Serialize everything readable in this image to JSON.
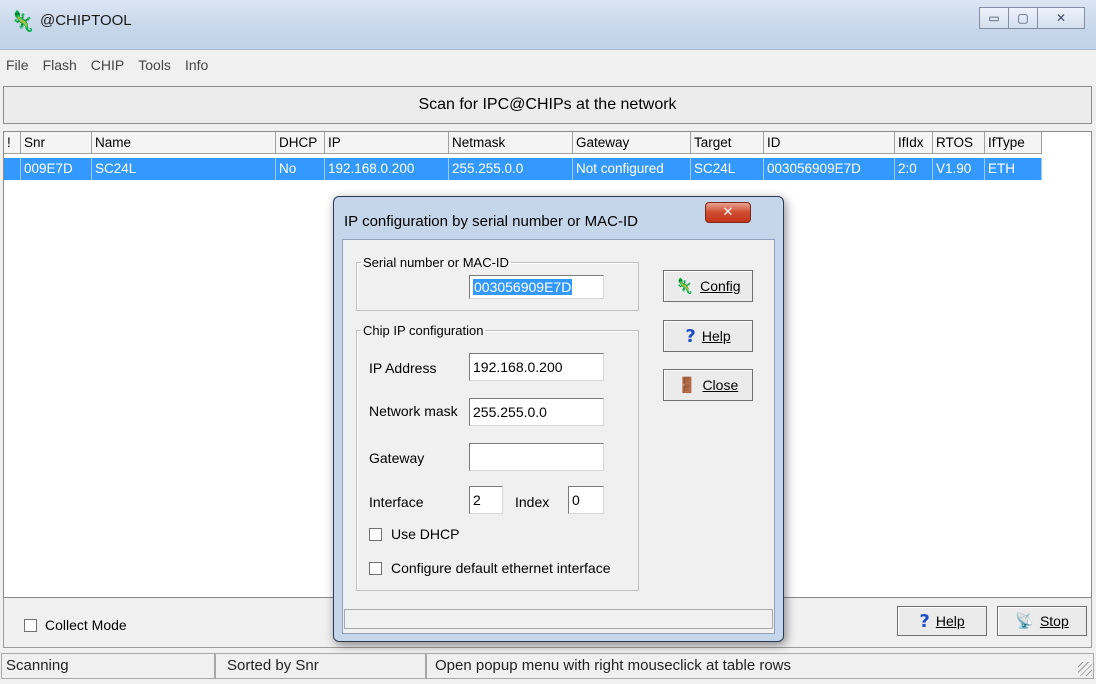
{
  "window": {
    "title": "@CHIPTOOL",
    "minimize": "▭",
    "maximize": "▢",
    "close": "✕"
  },
  "menu": [
    "File",
    "Flash",
    "CHIP",
    "Tools",
    "Info"
  ],
  "scan_bar": {
    "label": "Scan for IPC@CHIPs at the network"
  },
  "table": {
    "columns": [
      "!",
      "Snr",
      "Name",
      "DHCP",
      "IP",
      "Netmask",
      "Gateway",
      "Target",
      "ID",
      "IfIdx",
      "RTOS",
      "IfType"
    ],
    "rows": [
      [
        "",
        "009E7D",
        "SC24L",
        "No",
        "192.168.0.200",
        "255.255.0.0",
        "Not configured",
        "SC24L",
        "003056909E7D",
        "2:0",
        "V1.90",
        "ETH"
      ]
    ]
  },
  "bottom": {
    "collect_mode": "Collect Mode",
    "help": "Help",
    "stop": "Stop"
  },
  "statusbar": {
    "state": "Scanning",
    "sort": "Sorted by Snr",
    "hint": "Open popup menu with right mouseclick at table rows"
  },
  "dialog": {
    "title": "IP configuration by serial number or MAC-ID",
    "close": "✕",
    "serial_group": "Serial number or MAC-ID",
    "serial_value": "003056909E7D",
    "chip_group": "Chip IP configuration",
    "ip_label": "IP Address",
    "ip_value": "192.168.0.200",
    "mask_label": "Network mask",
    "mask_value": "255.255.0.0",
    "gateway_label": "Gateway",
    "gateway_value": "",
    "interface_label": "Interface",
    "interface_value": "2",
    "index_label": "Index",
    "index_value": "0",
    "use_dhcp": "Use DHCP",
    "default_eth": "Configure default ethernet interface",
    "config_btn": "Config",
    "help_btn": "Help",
    "close_btn": "Close"
  },
  "colors": {
    "selection": "#3399ff",
    "titlebar": "#c7d6ea",
    "dialog_frame": "#c5d5ea",
    "close_red": "#cf4b2f"
  },
  "icons": {
    "app": "chip-icon",
    "config": "chip-icon",
    "help": "question-icon",
    "close": "door-exit-icon",
    "stop": "satellite-dish-icon"
  }
}
